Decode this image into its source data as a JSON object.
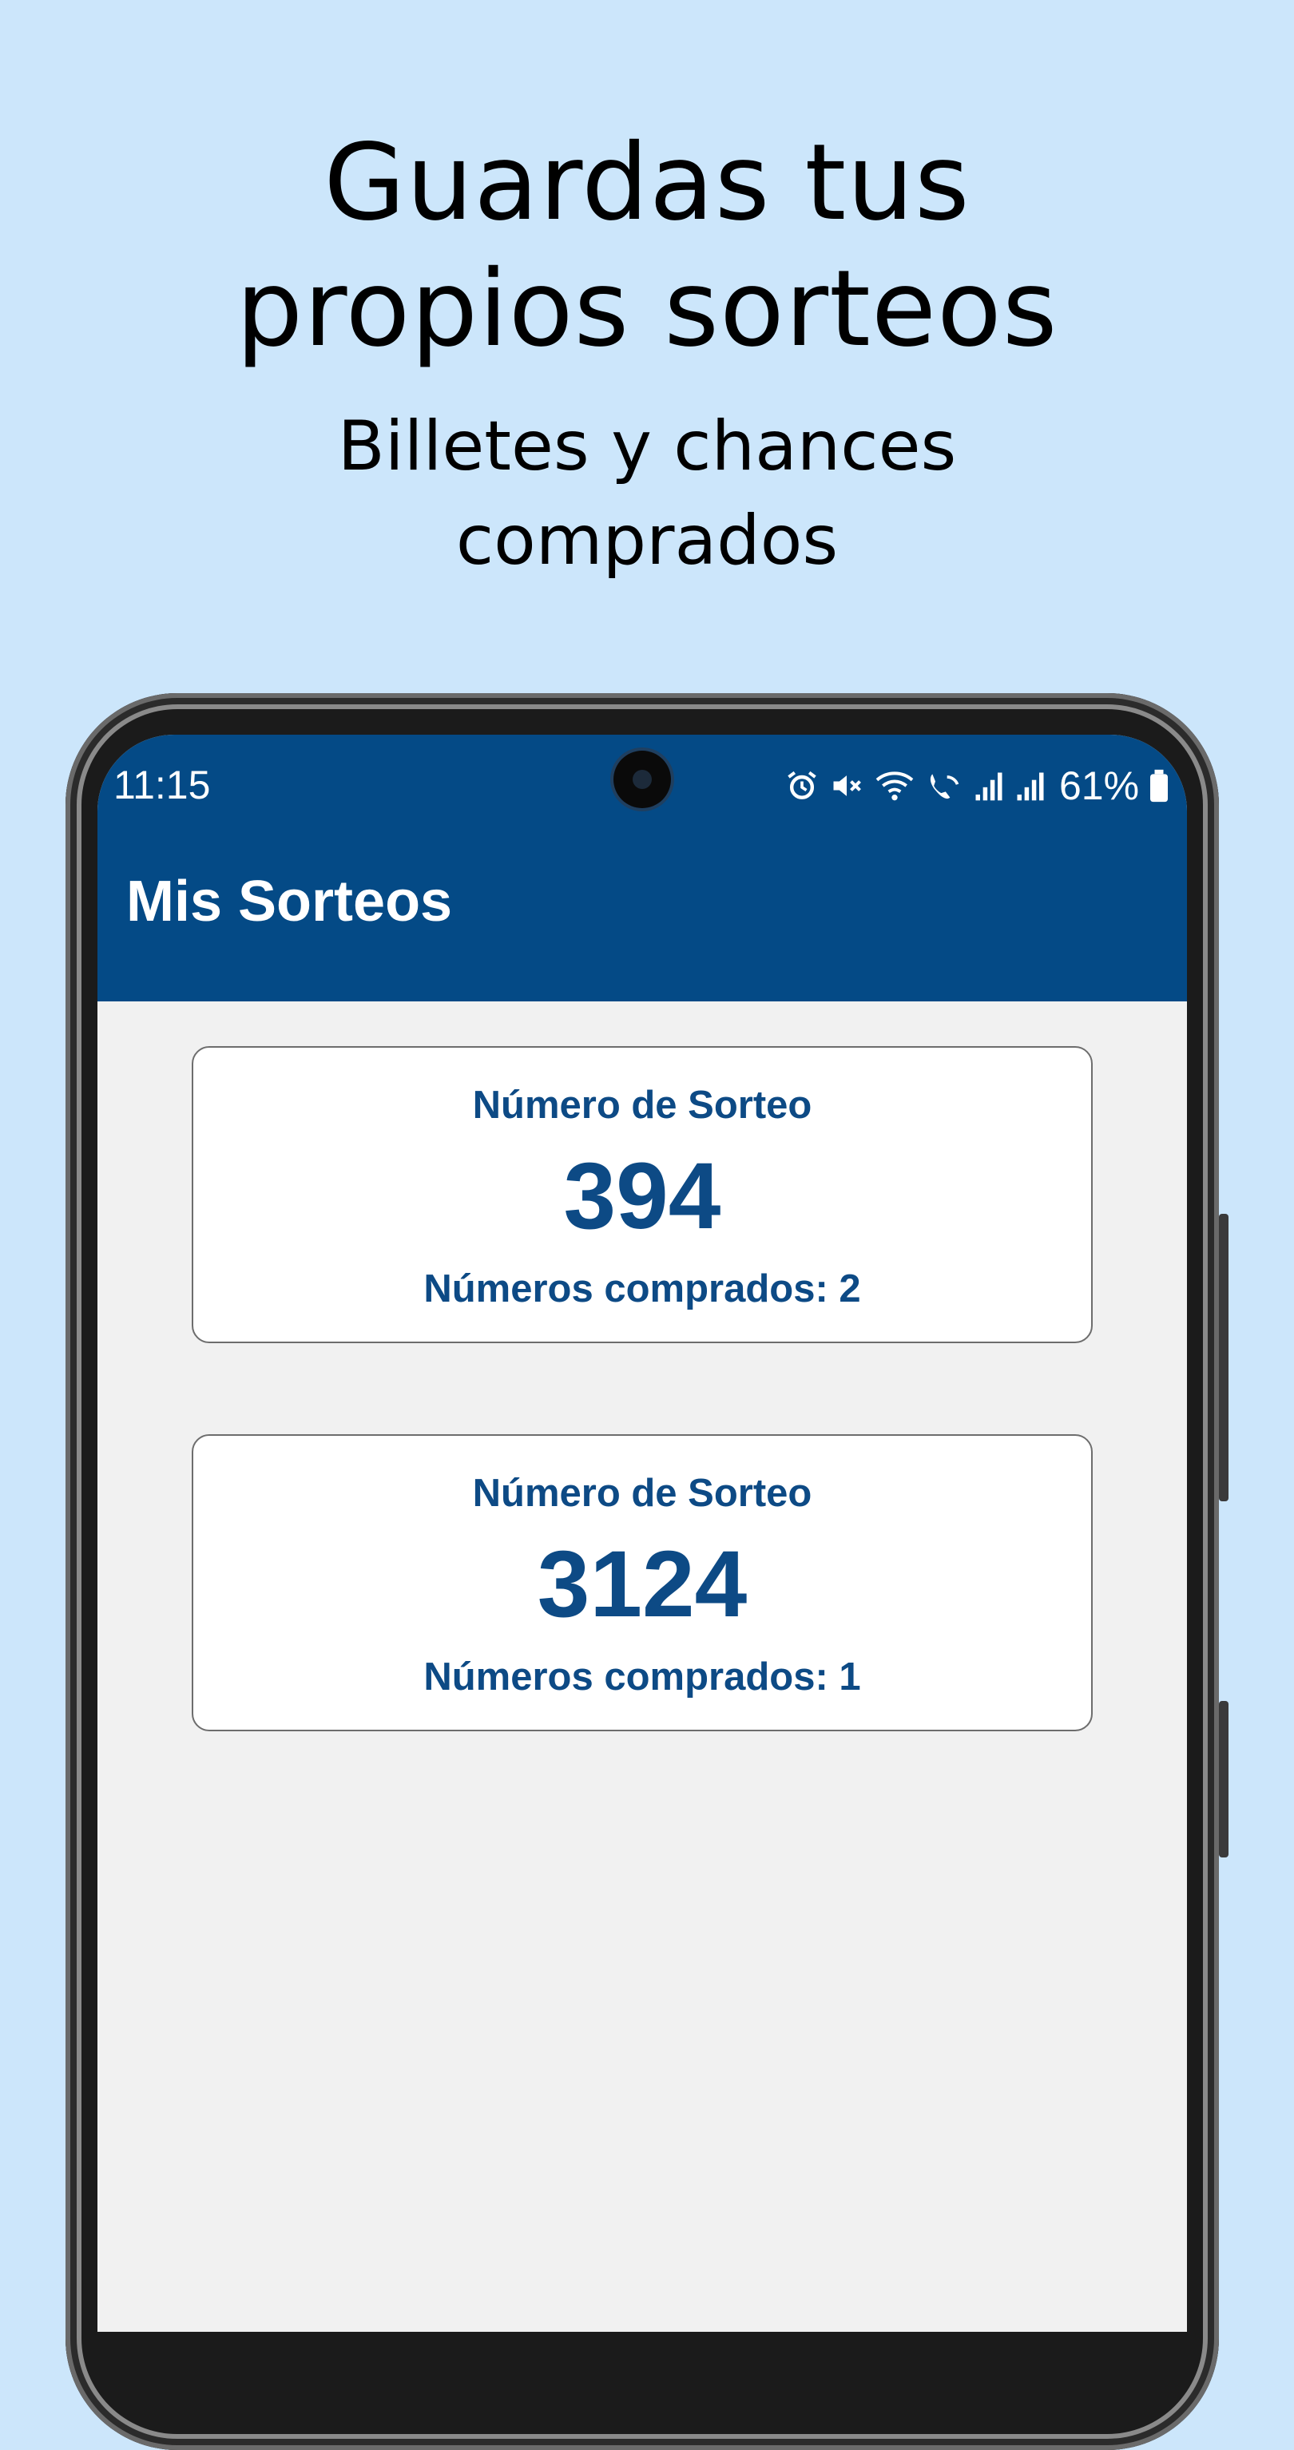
{
  "promo": {
    "title_line1": "Guardas tus",
    "title_line2": "propios sorteos",
    "subtitle_line1": "Billetes y chances",
    "subtitle_line2": "comprados"
  },
  "status_bar": {
    "time": "11:15",
    "battery": "61%",
    "icons": [
      "alarm-icon",
      "mute-icon",
      "wifi-icon",
      "wifi-call-icon",
      "signal-icon",
      "signal-icon",
      "battery-icon"
    ]
  },
  "app_bar": {
    "title": "Mis Sorteos",
    "color": "#044a86"
  },
  "draws": [
    {
      "label": "Número de Sorteo",
      "number": "394",
      "count_text": "Números comprados: 2"
    },
    {
      "label": "Número de Sorteo",
      "number": "3124",
      "count_text": "Números comprados: 1"
    }
  ],
  "colors": {
    "background": "#cce6fb",
    "accent": "#0d4a85",
    "screen": "#f1f1f1"
  }
}
